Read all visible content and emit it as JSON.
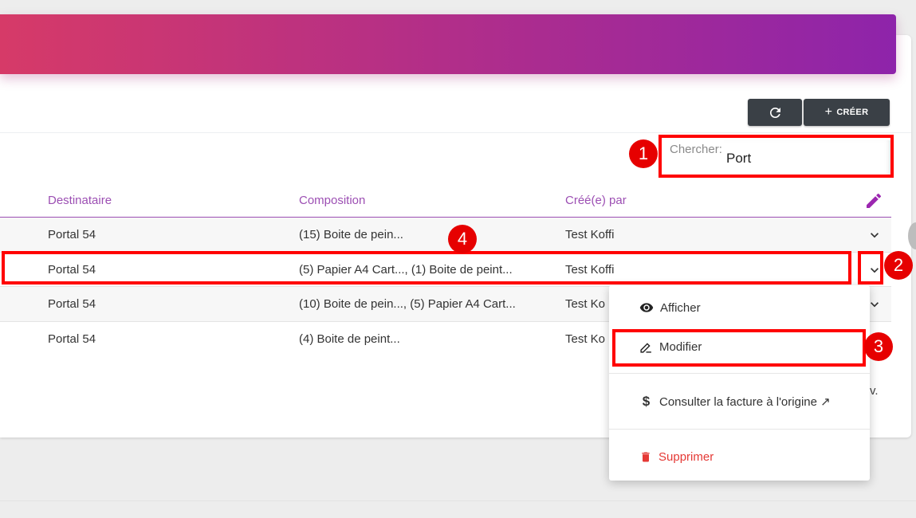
{
  "toolbar": {
    "create_label": "CRÉER",
    "plus_glyph": "+",
    "refresh_glyph": "⟳"
  },
  "search": {
    "label": "Chercher:",
    "value": "Port"
  },
  "table": {
    "columns": [
      "Destinataire",
      "Composition",
      "Créé(e) par"
    ],
    "rows": [
      {
        "destinataire": "Portal 54",
        "composition": "(15) Boite de pein...",
        "cree_par": "Test Koffi"
      },
      {
        "destinataire": "Portal 54",
        "composition": "(5) Papier A4 Cart..., (1) Boite de peint...",
        "cree_par": "Test Koffi"
      },
      {
        "destinataire": "Portal 54",
        "composition": "(10) Boite de pein..., (5) Papier A4 Cart...",
        "cree_par": "Test Ko"
      },
      {
        "destinataire": "Portal 54",
        "composition": "(4) Boite de peint...",
        "cree_par": "Test Ko"
      }
    ]
  },
  "menu": {
    "items": [
      {
        "label": "Afficher",
        "icon": "eye-icon"
      },
      {
        "label": "Modifier",
        "icon": "pencil-icon"
      },
      {
        "label": "Consulter la facture à l'origine ↗",
        "icon": "dollar-icon"
      },
      {
        "label": "Supprimer",
        "icon": "trash-icon"
      }
    ]
  },
  "annotations": [
    "1",
    "2",
    "3",
    "4"
  ],
  "trailing_text": "v.",
  "colors": {
    "gradient_start": "#d63a68",
    "gradient_end": "#8e24aa",
    "accent_purple": "#9c4fb3",
    "annotation_red": "#ff0000",
    "danger": "#e53935",
    "dark_button": "#3a4046"
  }
}
